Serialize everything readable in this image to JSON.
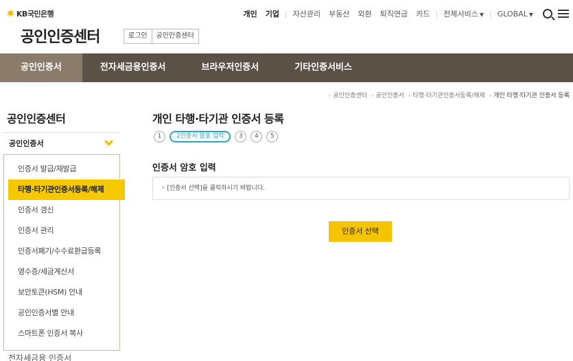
{
  "brand": {
    "logo_star": "✱",
    "logo_text": "KB국민은행",
    "site_title": "공인인증센터"
  },
  "header": {
    "login": "로그인",
    "cert_center": "공인인증센터"
  },
  "gnb": {
    "personal": "개인",
    "corporate": "기업",
    "asset": "자산관리",
    "realestate": "부동산",
    "fx": "외환",
    "pension": "퇴직연금",
    "card": "카드",
    "all_services": "전체서비스",
    "global": "GLOBAL"
  },
  "mainnav": {
    "tabs": [
      {
        "label": "공인인증서"
      },
      {
        "label": "전자세금용인증서"
      },
      {
        "label": "브라우저인증서"
      },
      {
        "label": "기타인증서비스"
      }
    ]
  },
  "breadcrumb": {
    "items": [
      "공인인증센터",
      "공인인증서",
      "타행·타기관인증서등록/해제",
      "개인 타행·타기관 인증서 등록"
    ]
  },
  "sidebar": {
    "title": "공인인증센터",
    "section": "공인인증서",
    "items": [
      {
        "label": "인증서 발급/재발급"
      },
      {
        "label": "타행·타기관인증서등록/해제"
      },
      {
        "label": "인증서 갱신"
      },
      {
        "label": "인증서 관리"
      },
      {
        "label": "인증서폐기/수수료환급등록"
      },
      {
        "label": "영수증/세금계산서"
      },
      {
        "label": "보안토큰(HSM) 안내"
      },
      {
        "label": "공인인증서별 안내"
      },
      {
        "label": "스마트폰 인증서 복사"
      }
    ],
    "next_section": "전자세금용 인증서"
  },
  "content": {
    "title": "개인 타행·타기관 인증서 등록",
    "steps": [
      "1",
      "2인증서 암호 입력",
      "3",
      "4",
      "5"
    ],
    "section_title": "인증서 암호 입력",
    "info_bullet": "•",
    "info_text": "[인증서 선택]을 클릭하시기 바랍니다.",
    "select_button": "인증서 선택"
  },
  "colors": {
    "nav_bg": "#5c5146",
    "nav_active": "#8a7b6b",
    "accent_yellow": "#f5c400",
    "step_active": "#29a3c9"
  }
}
